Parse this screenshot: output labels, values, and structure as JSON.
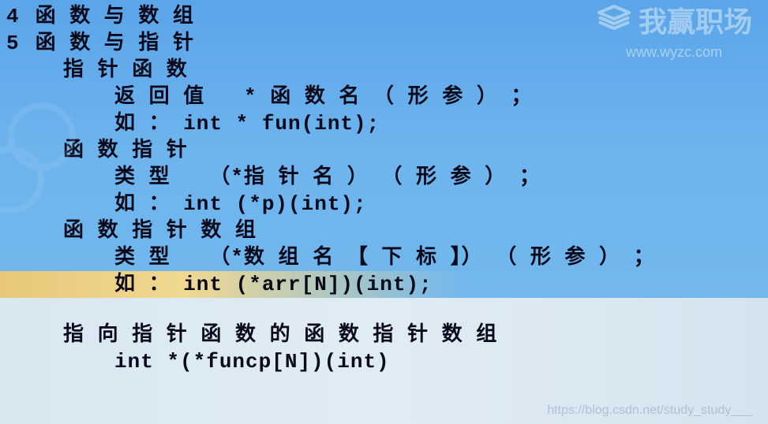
{
  "watermark": {
    "brand": "我赢职场",
    "url": "www.wyzc.com"
  },
  "bottom_url": "https://blog.csdn.net/study_study___",
  "lines": {
    "num4": "4",
    "num5": "5",
    "l1": " 函 数 与 数 组",
    "l2": " 函 数 与 指 针",
    "l3": "指 针 函 数",
    "l4": "返 回 值   * 函 数 名 （ 形 参 ） ；",
    "l5": "如 ： int * fun(int);",
    "l6": "函 数 指 针",
    "l7": "类 型   （*指 针 名 ） （ 形 参 ） ；",
    "l8": "如 ： int (*p)(int);",
    "l9": "函 数 指 针 数 组",
    "l10": "类 型   （*数 组 名 【 下 标 】） （ 形 参 ） ；",
    "l11": "如 ： int (*arr[N])(int);",
    "l12": "指 向 指 针 函 数 的 函 数 指 针 数 组",
    "l13": "int *(*funcp[N])(int)"
  }
}
